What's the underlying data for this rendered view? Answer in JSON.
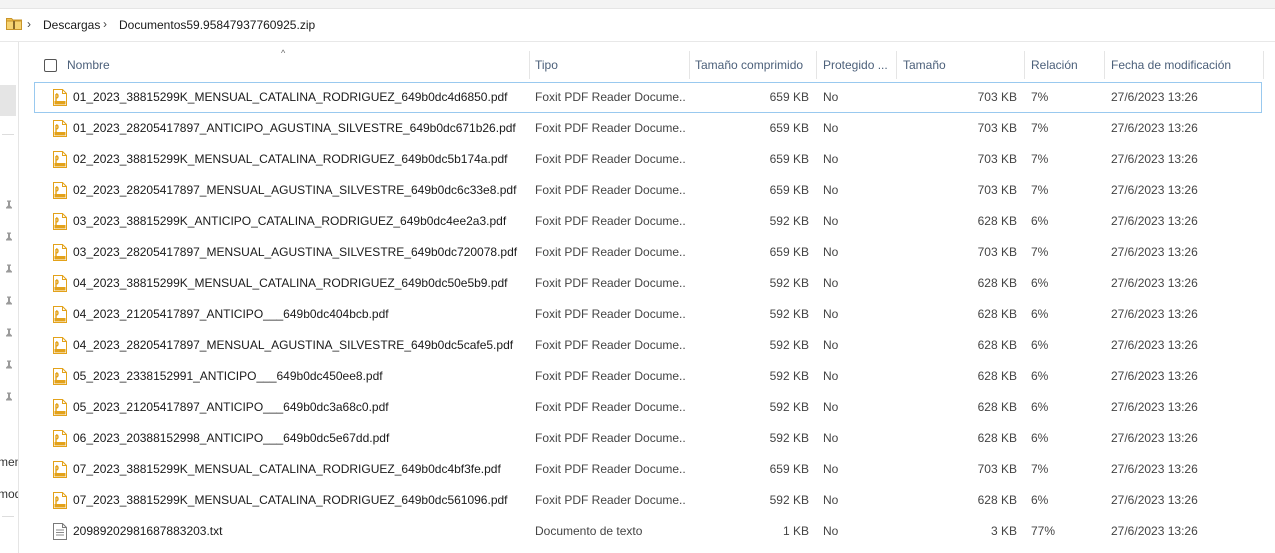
{
  "breadcrumb": {
    "items": [
      "Descargas",
      "Documentos59.95847937760925.zip"
    ],
    "separator": "›"
  },
  "nav_pane": {
    "pin_count": 7,
    "partial_texts": [
      "ment",
      "mod"
    ]
  },
  "columns": {
    "name": "Nombre",
    "type": "Tipo",
    "compressed_size": "Tamaño comprimido",
    "protected": "Protegido ...",
    "size": "Tamaño",
    "ratio": "Relación",
    "modified": "Fecha de modificación"
  },
  "files": [
    {
      "name": "01_2023_38815299K_MENSUAL_CATALINA_RODRIGUEZ_649b0dc4d6850.pdf",
      "icon": "pdf-icon",
      "type": "Foxit PDF Reader Docume...",
      "compressed": "659 KB",
      "protected": "No",
      "size": "703 KB",
      "ratio": "7%",
      "modified": "27/6/2023 13:26",
      "selected": true
    },
    {
      "name": "01_2023_28205417897_ANTICIPO_AGUSTINA_SILVESTRE_649b0dc671b26.pdf",
      "icon": "pdf-icon",
      "type": "Foxit PDF Reader Docume...",
      "compressed": "659 KB",
      "protected": "No",
      "size": "703 KB",
      "ratio": "7%",
      "modified": "27/6/2023 13:26"
    },
    {
      "name": "02_2023_38815299K_MENSUAL_CATALINA_RODRIGUEZ_649b0dc5b174a.pdf",
      "icon": "pdf-icon",
      "type": "Foxit PDF Reader Docume...",
      "compressed": "659 KB",
      "protected": "No",
      "size": "703 KB",
      "ratio": "7%",
      "modified": "27/6/2023 13:26"
    },
    {
      "name": "02_2023_28205417897_MENSUAL_AGUSTINA_SILVESTRE_649b0dc6c33e8.pdf",
      "icon": "pdf-icon",
      "type": "Foxit PDF Reader Docume...",
      "compressed": "659 KB",
      "protected": "No",
      "size": "703 KB",
      "ratio": "7%",
      "modified": "27/6/2023 13:26"
    },
    {
      "name": "03_2023_38815299K_ANTICIPO_CATALINA_RODRIGUEZ_649b0dc4ee2a3.pdf",
      "icon": "pdf-icon",
      "type": "Foxit PDF Reader Docume...",
      "compressed": "592 KB",
      "protected": "No",
      "size": "628 KB",
      "ratio": "6%",
      "modified": "27/6/2023 13:26"
    },
    {
      "name": "03_2023_28205417897_MENSUAL_AGUSTINA_SILVESTRE_649b0dc720078.pdf",
      "icon": "pdf-icon",
      "type": "Foxit PDF Reader Docume...",
      "compressed": "659 KB",
      "protected": "No",
      "size": "703 KB",
      "ratio": "7%",
      "modified": "27/6/2023 13:26"
    },
    {
      "name": "04_2023_38815299K_MENSUAL_CATALINA_RODRIGUEZ_649b0dc50e5b9.pdf",
      "icon": "pdf-icon",
      "type": "Foxit PDF Reader Docume...",
      "compressed": "592 KB",
      "protected": "No",
      "size": "628 KB",
      "ratio": "6%",
      "modified": "27/6/2023 13:26"
    },
    {
      "name": "04_2023_21205417897_ANTICIPO___649b0dc404bcb.pdf",
      "icon": "pdf-icon",
      "type": "Foxit PDF Reader Docume...",
      "compressed": "592 KB",
      "protected": "No",
      "size": "628 KB",
      "ratio": "6%",
      "modified": "27/6/2023 13:26"
    },
    {
      "name": "04_2023_28205417897_MENSUAL_AGUSTINA_SILVESTRE_649b0dc5cafe5.pdf",
      "icon": "pdf-icon",
      "type": "Foxit PDF Reader Docume...",
      "compressed": "592 KB",
      "protected": "No",
      "size": "628 KB",
      "ratio": "6%",
      "modified": "27/6/2023 13:26"
    },
    {
      "name": "05_2023_2338152991_ANTICIPO___649b0dc450ee8.pdf",
      "icon": "pdf-icon",
      "type": "Foxit PDF Reader Docume...",
      "compressed": "592 KB",
      "protected": "No",
      "size": "628 KB",
      "ratio": "6%",
      "modified": "27/6/2023 13:26"
    },
    {
      "name": "05_2023_21205417897_ANTICIPO___649b0dc3a68c0.pdf",
      "icon": "pdf-icon",
      "type": "Foxit PDF Reader Docume...",
      "compressed": "592 KB",
      "protected": "No",
      "size": "628 KB",
      "ratio": "6%",
      "modified": "27/6/2023 13:26"
    },
    {
      "name": "06_2023_20388152998_ANTICIPO___649b0dc5e67dd.pdf",
      "icon": "pdf-icon",
      "type": "Foxit PDF Reader Docume...",
      "compressed": "592 KB",
      "protected": "No",
      "size": "628 KB",
      "ratio": "6%",
      "modified": "27/6/2023 13:26"
    },
    {
      "name": "07_2023_38815299K_MENSUAL_CATALINA_RODRIGUEZ_649b0dc4bf3fe.pdf",
      "icon": "pdf-icon",
      "type": "Foxit PDF Reader Docume...",
      "compressed": "659 KB",
      "protected": "No",
      "size": "703 KB",
      "ratio": "7%",
      "modified": "27/6/2023 13:26"
    },
    {
      "name": "07_2023_38815299K_MENSUAL_CATALINA_RODRIGUEZ_649b0dc561096.pdf",
      "icon": "pdf-icon",
      "type": "Foxit PDF Reader Docume...",
      "compressed": "592 KB",
      "protected": "No",
      "size": "628 KB",
      "ratio": "6%",
      "modified": "27/6/2023 13:26"
    },
    {
      "name": "20989202981687883203.txt",
      "icon": "text-file-icon",
      "type": "Documento de texto",
      "compressed": "1 KB",
      "protected": "No",
      "size": "3 KB",
      "ratio": "77%",
      "modified": "27/6/2023 13:26"
    }
  ],
  "colors": {
    "header_text": "#4c607a",
    "selection_border": "#99c9ef",
    "pdf_icon": "#e3a21a",
    "folder_icon": "#f2c14e"
  }
}
